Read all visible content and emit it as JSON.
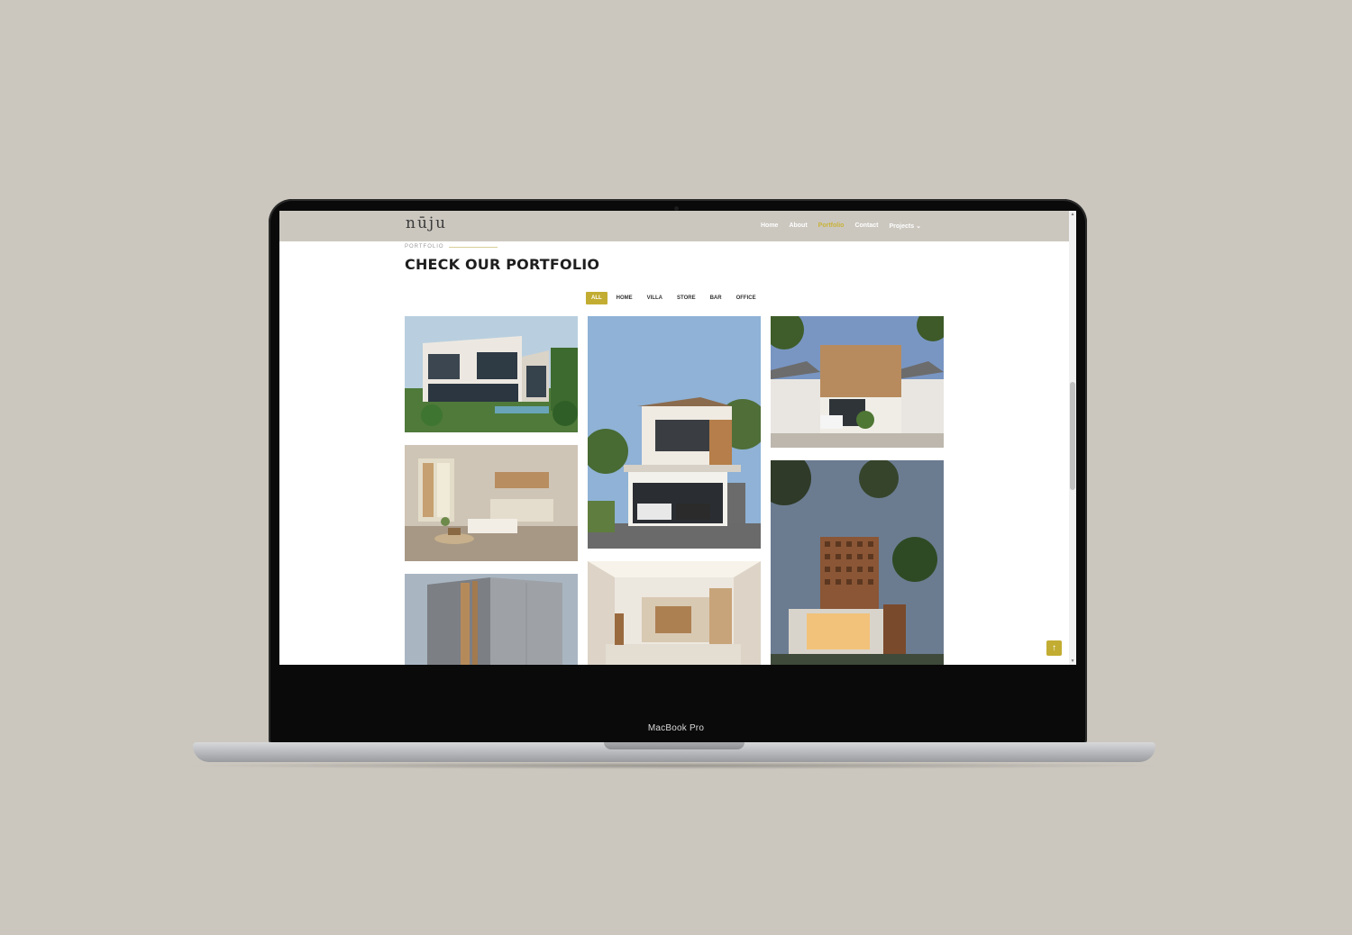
{
  "site": {
    "logo": "nūju",
    "nav": [
      {
        "label": "Home",
        "active": false
      },
      {
        "label": "About",
        "active": false
      },
      {
        "label": "Portfolio",
        "active": true
      },
      {
        "label": "Contact",
        "active": false
      },
      {
        "label": "Projects ⌄",
        "active": false
      }
    ]
  },
  "section": {
    "label": "PORTFOLIO",
    "title": "CHECK OUR PORTFOLIO"
  },
  "filters": [
    {
      "label": "ALL",
      "active": true
    },
    {
      "label": "HOME",
      "active": false
    },
    {
      "label": "VILLA",
      "active": false
    },
    {
      "label": "STORE",
      "active": false
    },
    {
      "label": "BAR",
      "active": false
    },
    {
      "label": "OFFICE",
      "active": false
    }
  ],
  "device": {
    "model": "MacBook Pro"
  },
  "colors": {
    "accent": "#c2ad32",
    "header_bg": "#cbc7bf",
    "background": "#cbc7bf"
  },
  "icons": {
    "back_to_top": "arrow-up-icon",
    "scroll_up": "triangle-up-icon",
    "scroll_down": "triangle-down-icon"
  }
}
